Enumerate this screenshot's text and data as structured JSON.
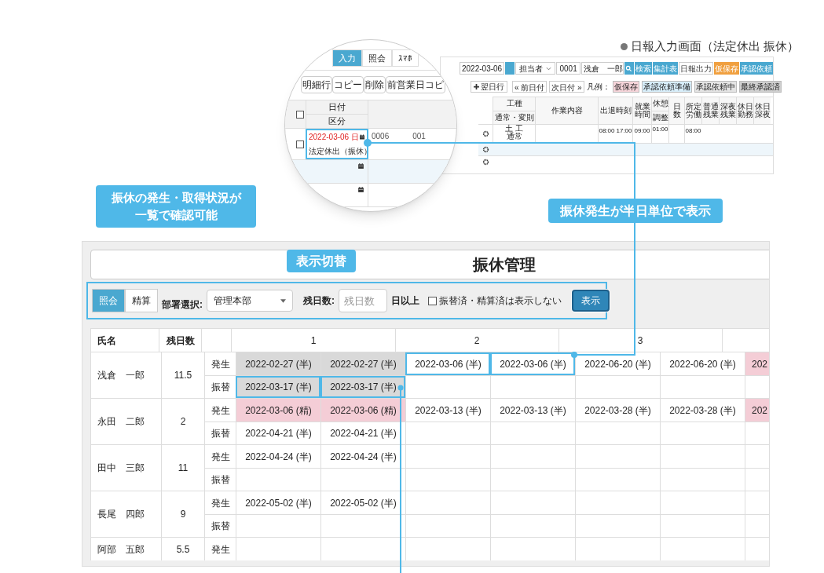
{
  "caption": "日報入力画面（法定休出 振休）",
  "daily_report_window": {
    "date": "2022-03-06",
    "staff_select": "担当者",
    "code": "0001",
    "name": "浅倉　一郎",
    "buttons": [
      {
        "label": "検索",
        "kind": "blue"
      },
      {
        "label": "集計表",
        "kind": "blue"
      },
      {
        "label": "日報出力",
        "kind": "plain"
      },
      {
        "label": "仮保存",
        "kind": "orange"
      },
      {
        "label": "承認依頼",
        "kind": "blue"
      }
    ],
    "add_row_button": "翌日行",
    "nav": [
      "« 前日付",
      "次日付 »"
    ],
    "legend_label": "凡例：",
    "legend": [
      {
        "label": "仮保存",
        "color": "#f6d5da"
      },
      {
        "label": "承認依頼準備",
        "color": "#d8eefa"
      },
      {
        "label": "承認依頼中",
        "color": "#e4e4e4"
      },
      {
        "label": "最終承認済",
        "color": "#d0d0d0"
      }
    ],
    "columns": [
      {
        "top": "工種",
        "bottom": "通常・変則"
      },
      {
        "top": "作業内容"
      },
      {
        "top": "出退時刻"
      },
      {
        "top": "就業時間"
      },
      {
        "top": "休憩",
        "bottom": "調整"
      },
      {
        "top": "日数"
      },
      {
        "top": "所定労働"
      },
      {
        "top": "普通残業"
      },
      {
        "top": "深夜残業"
      },
      {
        "top": "休日勤務"
      },
      {
        "top": "休日深夜"
      }
    ],
    "row": {
      "work_type": "土 工",
      "work_kind": "通常",
      "start": "08:00",
      "end": "17:00",
      "hours": "09:00",
      "break": "01:00",
      "regular": "08:00"
    }
  },
  "magnifier": {
    "tabs": [
      {
        "label": "入力",
        "selected": true
      },
      {
        "label": "照会",
        "selected": false
      },
      {
        "label": "ｽﾏﾎ",
        "selected": false
      }
    ],
    "select_all": {
      "checked": false
    },
    "buttons": [
      "明細行",
      "コピー",
      "削除",
      "前営業日コピ"
    ],
    "headers": [
      "日付",
      "区分"
    ],
    "entry": {
      "checked": false,
      "date": "2022-03-06 日",
      "category": "法定休出（振休）"
    },
    "codes": [
      "0006",
      "001"
    ]
  },
  "callouts": [
    "振休の発生・取得状況が一覧で確認可能",
    "振休発生が半日単位で表示",
    "表示切替"
  ],
  "furikyu": {
    "title": "振休管理",
    "view_tabs": [
      {
        "label": "照会",
        "selected": true
      },
      {
        "label": "精算",
        "selected": false
      }
    ],
    "dept_label": "部署選択:",
    "dept_select": "管理本部",
    "remain_label": "残日数:",
    "remain_placeholder": "残日数",
    "remain_suffix": "日以上",
    "hide_checkbox": {
      "label": "振替済・精算済は表示しない",
      "checked": false
    },
    "show_button": "表示",
    "table": {
      "columns": [
        "氏名",
        "残日数"
      ],
      "groups": [
        "1",
        "2",
        "3"
      ],
      "people": [
        {
          "name": "浅倉　一郎",
          "remaining": "11.5",
          "rows": [
            {
              "type": "発生",
              "cells": [
                {
                  "text": "2022-02-27 (半)",
                  "color": "#d9d9d9",
                  "framed": false
                },
                {
                  "text": "2022-02-27 (半)",
                  "color": "#d9d9d9",
                  "framed": false
                },
                {
                  "text": "2022-03-06 (半)",
                  "framed": true
                },
                {
                  "text": "2022-03-06 (半)",
                  "framed": true
                },
                {
                  "text": "2022-06-20 (半)",
                  "framed": false
                },
                {
                  "text": "2022-06-20 (半)",
                  "framed": false
                },
                {
                  "text": "202",
                  "color": "#f4cdd6",
                  "framed": false
                }
              ]
            },
            {
              "type": "振替",
              "cells": [
                {
                  "text": "2022-03-17 (半)",
                  "color": "#d9d9d9",
                  "framed": true
                },
                {
                  "text": "2022-03-17 (半)",
                  "color": "#d9d9d9",
                  "framed": true
                }
              ]
            }
          ]
        },
        {
          "name": "永田　二郎",
          "remaining": "2",
          "rows": [
            {
              "type": "発生",
              "cells": [
                {
                  "text": "2022-03-06 (精)",
                  "color": "#f4cdd6",
                  "framed": false
                },
                {
                  "text": "2022-03-06 (精)",
                  "color": "#f4cdd6",
                  "framed": false
                },
                {
                  "text": "2022-03-13 (半)",
                  "framed": false
                },
                {
                  "text": "2022-03-13 (半)",
                  "framed": false
                },
                {
                  "text": "2022-03-28 (半)",
                  "framed": false
                },
                {
                  "text": "2022-03-28 (半)",
                  "framed": false
                },
                {
                  "text": "202",
                  "color": "#f4cdd6",
                  "framed": false
                }
              ]
            },
            {
              "type": "振替",
              "cells": [
                {
                  "text": "2022-04-21 (半)",
                  "framed": false
                },
                {
                  "text": "2022-04-21 (半)",
                  "framed": false
                }
              ]
            }
          ]
        },
        {
          "name": "田中　三郎",
          "remaining": "11",
          "rows": [
            {
              "type": "発生",
              "cells": [
                {
                  "text": "2022-04-24 (半)",
                  "framed": false
                },
                {
                  "text": "2022-04-24 (半)",
                  "framed": false
                }
              ]
            },
            {
              "type": "振替",
              "cells": []
            }
          ]
        },
        {
          "name": "長尾　四郎",
          "remaining": "9",
          "rows": [
            {
              "type": "発生",
              "cells": [
                {
                  "text": "2022-05-02 (半)",
                  "framed": false
                },
                {
                  "text": "2022-05-02 (半)",
                  "framed": false
                }
              ]
            },
            {
              "type": "振替",
              "cells": []
            }
          ]
        },
        {
          "name": "阿部　五郎",
          "remaining": "5.5",
          "rows": [
            {
              "type": "発生",
              "cells": []
            }
          ]
        }
      ]
    }
  }
}
